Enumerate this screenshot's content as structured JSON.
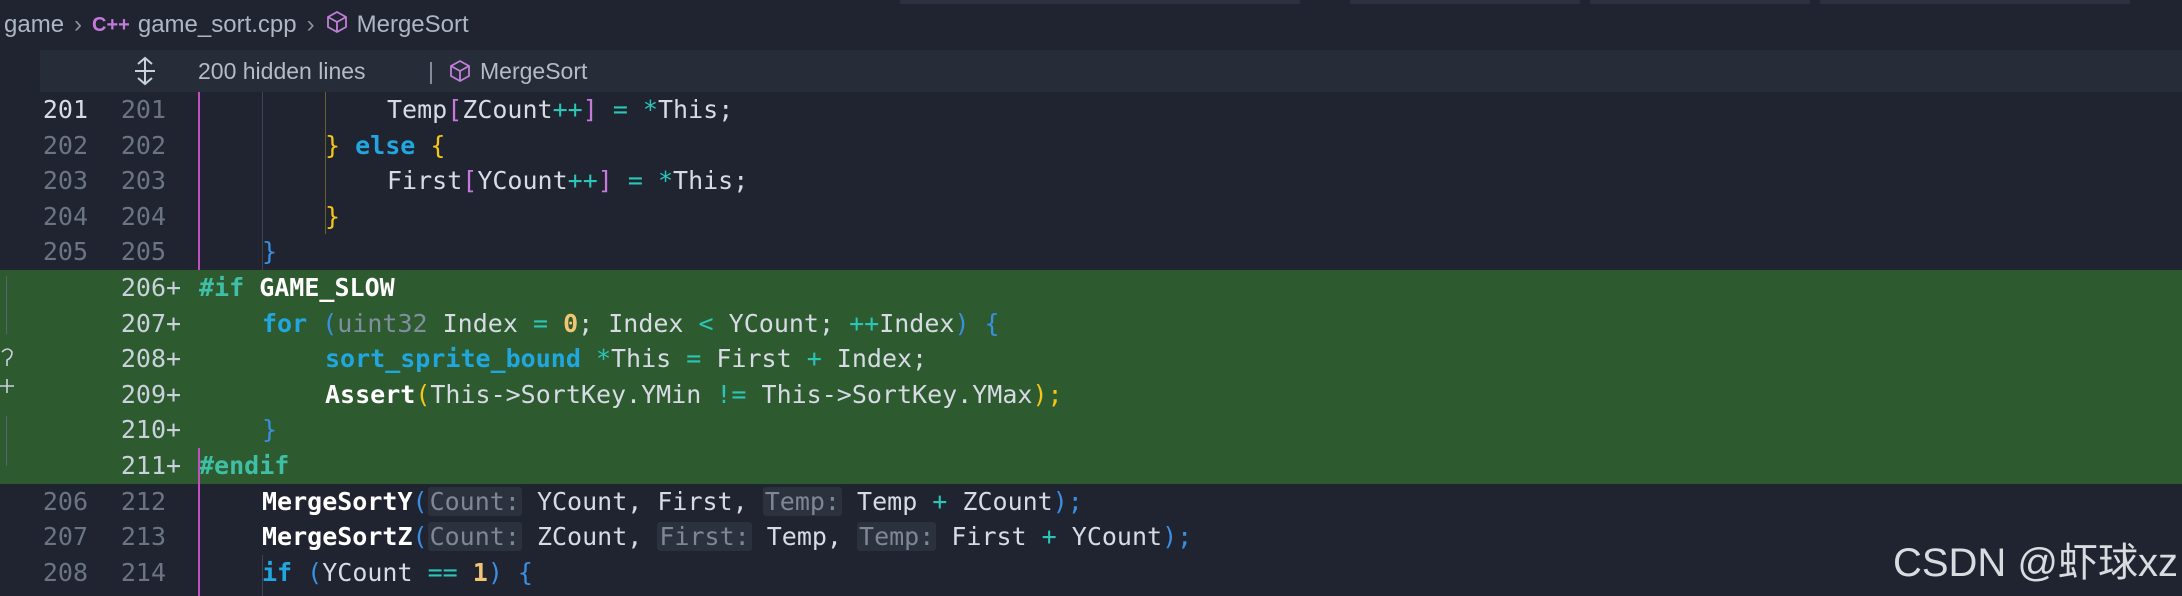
{
  "breadcrumb": {
    "folder": "game",
    "lang_badge": "C++",
    "file": "game_sort.cpp",
    "symbol": "MergeSort"
  },
  "hidden_bar": {
    "text": "200 hidden lines",
    "separator": "|",
    "symbol": "MergeSort"
  },
  "lines": [
    {
      "old": "201",
      "new": "201",
      "mark": ""
    },
    {
      "old": "202",
      "new": "202",
      "mark": ""
    },
    {
      "old": "203",
      "new": "203",
      "mark": ""
    },
    {
      "old": "204",
      "new": "204",
      "mark": ""
    },
    {
      "old": "205",
      "new": "205",
      "mark": ""
    },
    {
      "old": "",
      "new": "206",
      "mark": "+"
    },
    {
      "old": "",
      "new": "207",
      "mark": "+"
    },
    {
      "old": "",
      "new": "208",
      "mark": "+"
    },
    {
      "old": "",
      "new": "209",
      "mark": "+"
    },
    {
      "old": "",
      "new": "210",
      "mark": "+"
    },
    {
      "old": "",
      "new": "211",
      "mark": "+"
    },
    {
      "old": "206",
      "new": "212",
      "mark": ""
    },
    {
      "old": "207",
      "new": "213",
      "mark": ""
    },
    {
      "old": "208",
      "new": "214",
      "mark": ""
    }
  ],
  "code": {
    "l201": {
      "a": "Temp",
      "b": "[",
      "c": "ZCount",
      "d": "++",
      "e": "]",
      "f": " = ",
      "g": "*",
      "h": "This;"
    },
    "l202": {
      "a": "}",
      "b": " else ",
      "c": "{"
    },
    "l203": {
      "a": "First",
      "b": "[",
      "c": "YCount",
      "d": "++",
      "e": "]",
      "f": " = ",
      "g": "*",
      "h": "This;"
    },
    "l204": {
      "a": "}"
    },
    "l205": {
      "a": "}"
    },
    "l206": {
      "a": "#if",
      "b": " GAME_SLOW"
    },
    "l207": {
      "a": "for",
      "b": " (",
      "c": "uint32",
      "d": " Index ",
      "e": "=",
      "f": " ",
      "g": "0",
      "h": "; Index ",
      "i": "<",
      "j": " YCount; ",
      "k": "++",
      "l": "Index",
      "m": ") {"
    },
    "l208": {
      "a": "sort_sprite_bound",
      "b": " ",
      "c": "*",
      "d": "This ",
      "e": "=",
      "f": " First ",
      "g": "+",
      "h": " Index;"
    },
    "l209": {
      "a": "Assert",
      "b": "(",
      "c": "This->SortKey.YMin ",
      "d": "!=",
      "e": " This->SortKey.YMax",
      "f": ");"
    },
    "l210": {
      "a": "}"
    },
    "l211": {
      "a": "#endif"
    },
    "l212": {
      "a": "MergeSortY",
      "b": "(",
      "c": "Count:",
      "d": " YCount, First, ",
      "e": "Temp:",
      "f": " Temp ",
      "g": "+",
      "h": " ZCount",
      "i": ");"
    },
    "l213": {
      "a": "MergeSortZ",
      "b": "(",
      "c": "Count:",
      "d": " ZCount, ",
      "e": "First:",
      "f": " Temp, ",
      "g": "Temp:",
      "h": " First ",
      "i": "+",
      "j": " YCount",
      "k": ");"
    },
    "l214": {
      "a": "if",
      "b": " (",
      "c": "YCount ",
      "d": "==",
      "e": " ",
      "f": "1",
      "g": ") {"
    }
  },
  "watermark": "CSDN @虾球xz",
  "colors": {
    "background": "#1f2430",
    "added_line": "#2e5a2f",
    "keyword": "#21a7e0",
    "preprocessor": "#3fbfa6",
    "bracket_magenta": "#c678dd",
    "bracket_yellow": "#f5c518"
  }
}
